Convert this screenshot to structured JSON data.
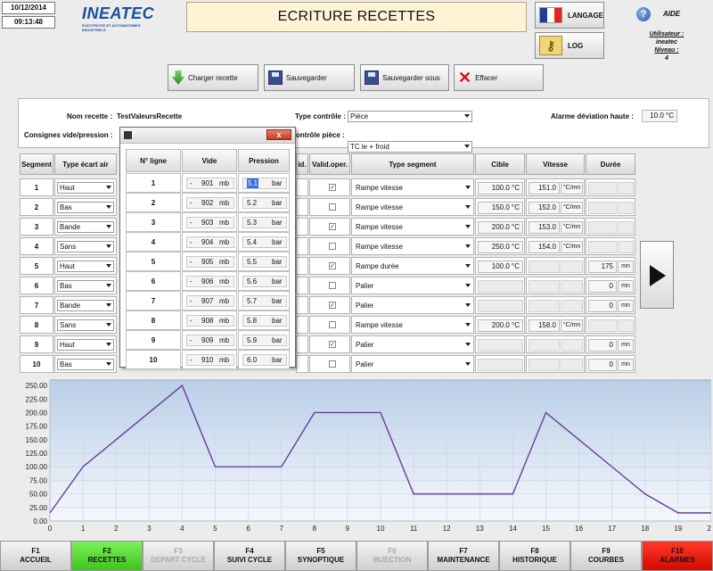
{
  "header": {
    "date": "10/12/2014",
    "time": "09:13:48",
    "logo_brand": "INEATEC",
    "logo_tagline": "ELECTRICITE ET AUTOMATISMES INDUSTRIELS",
    "title": "ECRITURE RECETTES",
    "langage_label": "LANGAGE",
    "log_label": "LOG",
    "aide_label": "AIDE",
    "user_label": "Utilisateur :",
    "user_name": "ineatec",
    "level_label": "Niveau :",
    "level_value": "4",
    "flag_colors": [
      "#1f3c9b",
      "#ffffff",
      "#e52222"
    ]
  },
  "actions": {
    "charger": "Charger recette",
    "sauvegarder": "Sauvegarder",
    "sauvegarder_sous": "Sauvegarder sous",
    "effacer": "Effacer"
  },
  "info": {
    "nom_recette_label": "Nom recette :",
    "nom_recette_value": "TestValeursRecette",
    "type_controle_label": "Type contrôle :",
    "type_controle_value": "Pièce",
    "alarme_label": "Alarme déviation haute :",
    "alarme_value": "10.0 °C",
    "consignes_label": "Consignes vide/pression :",
    "controle_piece_label": "ontrôle pièce :",
    "controle_piece_value": "TC le + froid"
  },
  "table": {
    "headers": {
      "segment": "Segment",
      "type_ecart_air": "Type écart air",
      "valid_short": "id.",
      "valid_oper": "Valid.oper.",
      "type_segment": "Type segment",
      "cible": "Cible",
      "vitesse": "Vitesse",
      "duree": "Durée"
    },
    "rows": [
      {
        "seg": "1",
        "ecart": "Haut",
        "checked": "✓",
        "type": "Rampe vitesse",
        "cible": "100.0 °C",
        "vit": "151.0",
        "vit_unit": "°C/mn",
        "duree": "",
        "duree_unit": ""
      },
      {
        "seg": "2",
        "ecart": "Bas",
        "checked": "",
        "type": "Rampe vitesse",
        "cible": "150.0 °C",
        "vit": "152.0",
        "vit_unit": "°C/mn",
        "duree": "",
        "duree_unit": ""
      },
      {
        "seg": "3",
        "ecart": "Bande",
        "checked": "✓",
        "type": "Rampe vitesse",
        "cible": "200.0 °C",
        "vit": "153.0",
        "vit_unit": "°C/mn",
        "duree": "",
        "duree_unit": ""
      },
      {
        "seg": "4",
        "ecart": "Sans",
        "checked": "",
        "type": "Rampe vitesse",
        "cible": "250.0 °C",
        "vit": "154.0",
        "vit_unit": "°C/mn",
        "duree": "",
        "duree_unit": ""
      },
      {
        "seg": "5",
        "ecart": "Haut",
        "checked": "✓",
        "type": "Rampe durée",
        "cible": "100.0 °C",
        "vit": "",
        "vit_unit": "",
        "duree": "175",
        "duree_unit": "mn"
      },
      {
        "seg": "6",
        "ecart": "Bas",
        "checked": "",
        "type": "Palier",
        "cible": "",
        "vit": "",
        "vit_unit": "",
        "duree": "0",
        "duree_unit": "mn"
      },
      {
        "seg": "7",
        "ecart": "Bande",
        "checked": "✓",
        "type": "Palier",
        "cible": "",
        "vit": "",
        "vit_unit": "",
        "duree": "0",
        "duree_unit": "mn"
      },
      {
        "seg": "8",
        "ecart": "Sans",
        "checked": "",
        "type": "Rampe vitesse",
        "cible": "200.0 °C",
        "vit": "158.0",
        "vit_unit": "°C/mn",
        "duree": "",
        "duree_unit": ""
      },
      {
        "seg": "9",
        "ecart": "Haut",
        "checked": "✓",
        "type": "Palier",
        "cible": "",
        "vit": "",
        "vit_unit": "",
        "duree": "0",
        "duree_unit": "mn"
      },
      {
        "seg": "10",
        "ecart": "Bas",
        "checked": "",
        "type": "Palier",
        "cible": "",
        "vit": "",
        "vit_unit": "",
        "duree": "0",
        "duree_unit": "mn"
      }
    ]
  },
  "popup": {
    "headers": {
      "ligne": "N° ligne",
      "vide": "Vide",
      "pression": "Pression"
    },
    "close_label": "x",
    "vide_sign": "-",
    "vide_unit": "mb",
    "pression_unit": "bar",
    "rows": [
      {
        "n": "1",
        "vide": "901",
        "pression": "5.1"
      },
      {
        "n": "2",
        "vide": "902",
        "pression": "5.2"
      },
      {
        "n": "3",
        "vide": "903",
        "pression": "5.3"
      },
      {
        "n": "4",
        "vide": "904",
        "pression": "5.4"
      },
      {
        "n": "5",
        "vide": "905",
        "pression": "5.5"
      },
      {
        "n": "6",
        "vide": "906",
        "pression": "5.6"
      },
      {
        "n": "7",
        "vide": "907",
        "pression": "5.7"
      },
      {
        "n": "8",
        "vide": "908",
        "pression": "5.8"
      },
      {
        "n": "9",
        "vide": "909",
        "pression": "5.9"
      },
      {
        "n": "10",
        "vide": "910",
        "pression": "6.0"
      }
    ]
  },
  "chart_data": {
    "type": "line",
    "x": [
      0,
      1,
      2,
      3,
      4,
      5,
      6,
      7,
      8,
      9,
      10,
      11,
      12,
      13,
      14,
      15,
      16,
      17,
      18,
      19,
      20
    ],
    "series": [
      {
        "values": [
          15,
          100,
          150,
          200,
          250,
          100,
          100,
          100,
          200,
          200,
          200,
          50,
          50,
          50,
          50,
          200,
          150,
          100,
          50,
          15,
          15
        ]
      }
    ],
    "xlim": [
      0,
      20
    ],
    "ylim": [
      0,
      260
    ],
    "yticks": [
      "250.00",
      "225.00",
      "200.00",
      "175.00",
      "150.00",
      "125.00",
      "100.00",
      "75.00",
      "50.00",
      "25.00",
      "0.00"
    ],
    "ytick_values": [
      250,
      225,
      200,
      175,
      150,
      125,
      100,
      75,
      50,
      25,
      0
    ],
    "xticks": [
      "0",
      "1",
      "2",
      "3",
      "4",
      "5",
      "6",
      "7",
      "8",
      "9",
      "10",
      "11",
      "12",
      "13",
      "14",
      "15",
      "16",
      "17",
      "18",
      "19",
      "20"
    ],
    "grid": true,
    "line_color": "#6a3c9c"
  },
  "fkeys": [
    {
      "k": "F1",
      "label": "ACCUEIL",
      "state": "normal"
    },
    {
      "k": "F2",
      "label": "RECETTES",
      "state": "active"
    },
    {
      "k": "F3",
      "label": "DEPART CYCLE",
      "state": "disabled"
    },
    {
      "k": "F4",
      "label": "SUIVI CYCLE",
      "state": "normal"
    },
    {
      "k": "F5",
      "label": "SYNOPTIQUE",
      "state": "normal"
    },
    {
      "k": "F6",
      "label": "INJECTION",
      "state": "disabled"
    },
    {
      "k": "F7",
      "label": "MAINTENANCE",
      "state": "normal"
    },
    {
      "k": "F8",
      "label": "HISTORIQUE",
      "state": "normal"
    },
    {
      "k": "F9",
      "label": "COURBES",
      "state": "normal"
    },
    {
      "k": "F10",
      "label": "ALARMES",
      "state": "alarm"
    }
  ]
}
